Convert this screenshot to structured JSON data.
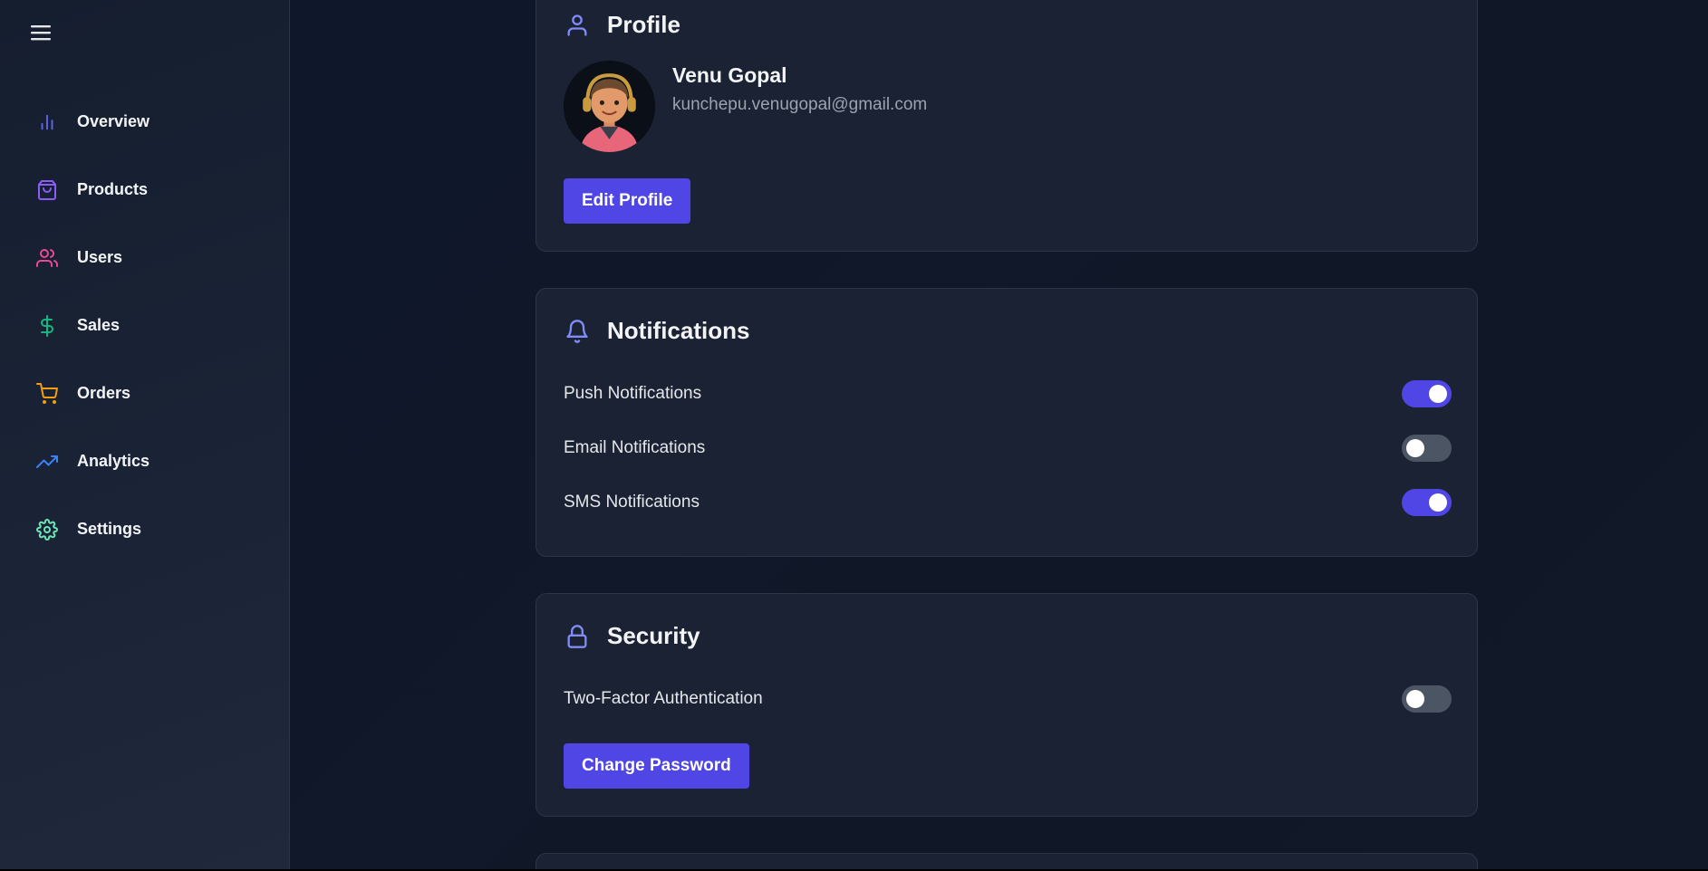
{
  "sidebar": {
    "menu_icon": "hamburger-icon",
    "items": [
      {
        "label": "Overview",
        "icon": "bar-chart-icon",
        "color": "#6366f1"
      },
      {
        "label": "Products",
        "icon": "shopping-bag-icon",
        "color": "#8b5cf6"
      },
      {
        "label": "Users",
        "icon": "users-icon",
        "color": "#ec4899"
      },
      {
        "label": "Sales",
        "icon": "dollar-sign-icon",
        "color": "#10b981"
      },
      {
        "label": "Orders",
        "icon": "shopping-cart-icon",
        "color": "#f59e0b"
      },
      {
        "label": "Analytics",
        "icon": "trending-up-icon",
        "color": "#3b82f6"
      },
      {
        "label": "Settings",
        "icon": "gear-icon",
        "color": "#6ee7b7"
      }
    ]
  },
  "profile": {
    "title": "Profile",
    "icon": "user-icon",
    "name": "Venu Gopal",
    "email": "kunchepu.venugopal@gmail.com",
    "edit_button": "Edit Profile"
  },
  "notifications": {
    "title": "Notifications",
    "icon": "bell-icon",
    "items": [
      {
        "label": "Push Notifications",
        "enabled": true
      },
      {
        "label": "Email Notifications",
        "enabled": false
      },
      {
        "label": "SMS Notifications",
        "enabled": true
      }
    ]
  },
  "security": {
    "title": "Security",
    "icon": "lock-icon",
    "two_factor_label": "Two-Factor Authentication",
    "two_factor_enabled": false,
    "change_password_button": "Change Password"
  },
  "colors": {
    "accent": "#4f46e5",
    "icon_accent": "#818cf8",
    "toggle_off": "#4b5563",
    "card_bg": "#1a2233"
  }
}
